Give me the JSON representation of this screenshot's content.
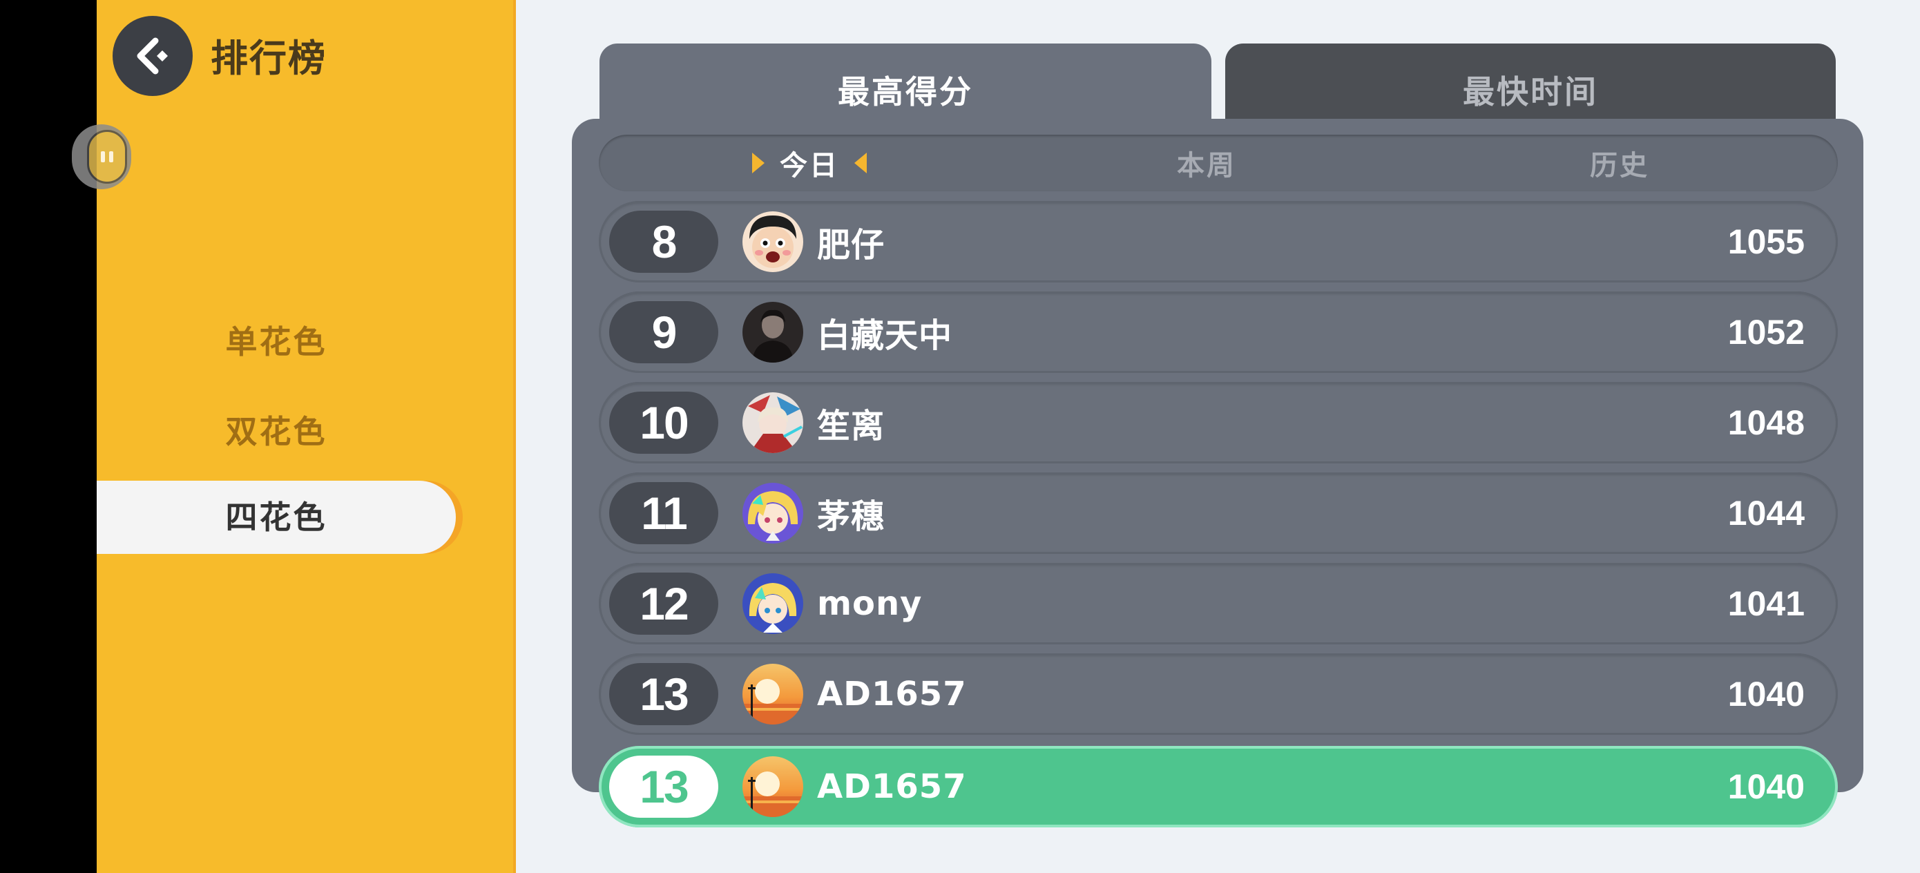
{
  "header": {
    "title": "排行榜"
  },
  "sidebar": {
    "items": [
      {
        "label": "单花色",
        "active": false
      },
      {
        "label": "双花色",
        "active": false
      },
      {
        "label": "四花色",
        "active": true
      }
    ]
  },
  "tabs": [
    {
      "label": "最高得分",
      "active": true
    },
    {
      "label": "最快时间",
      "active": false
    }
  ],
  "filters": [
    {
      "label": "今日",
      "active": true
    },
    {
      "label": "本周",
      "active": false
    },
    {
      "label": "历史",
      "active": false
    }
  ],
  "leaderboard": {
    "rows": [
      {
        "rank": "8",
        "name": "肥仔",
        "score": "1055",
        "avatar": "cartoon-boy-avatar"
      },
      {
        "rank": "9",
        "name": "白藏天中",
        "score": "1052",
        "avatar": "dark-portrait-avatar"
      },
      {
        "rank": "10",
        "name": "笙离",
        "score": "1048",
        "avatar": "anime-character-avatar"
      },
      {
        "rank": "11",
        "name": "茅穗",
        "score": "1044",
        "avatar": "blonde-anime-avatar"
      },
      {
        "rank": "12",
        "name": "mony",
        "score": "1041",
        "avatar": "blonde-anime-avatar"
      },
      {
        "rank": "13",
        "name": "AD1657",
        "score": "1040",
        "avatar": "sunset-avatar"
      }
    ],
    "me": {
      "rank": "13",
      "name": "AD1657",
      "score": "1040",
      "avatar": "sunset-avatar"
    }
  },
  "colors": {
    "sidebar": "#f7bb2b",
    "panel": "#6b717d",
    "accent": "#f5b62f",
    "me_row": "#4ec58e"
  }
}
